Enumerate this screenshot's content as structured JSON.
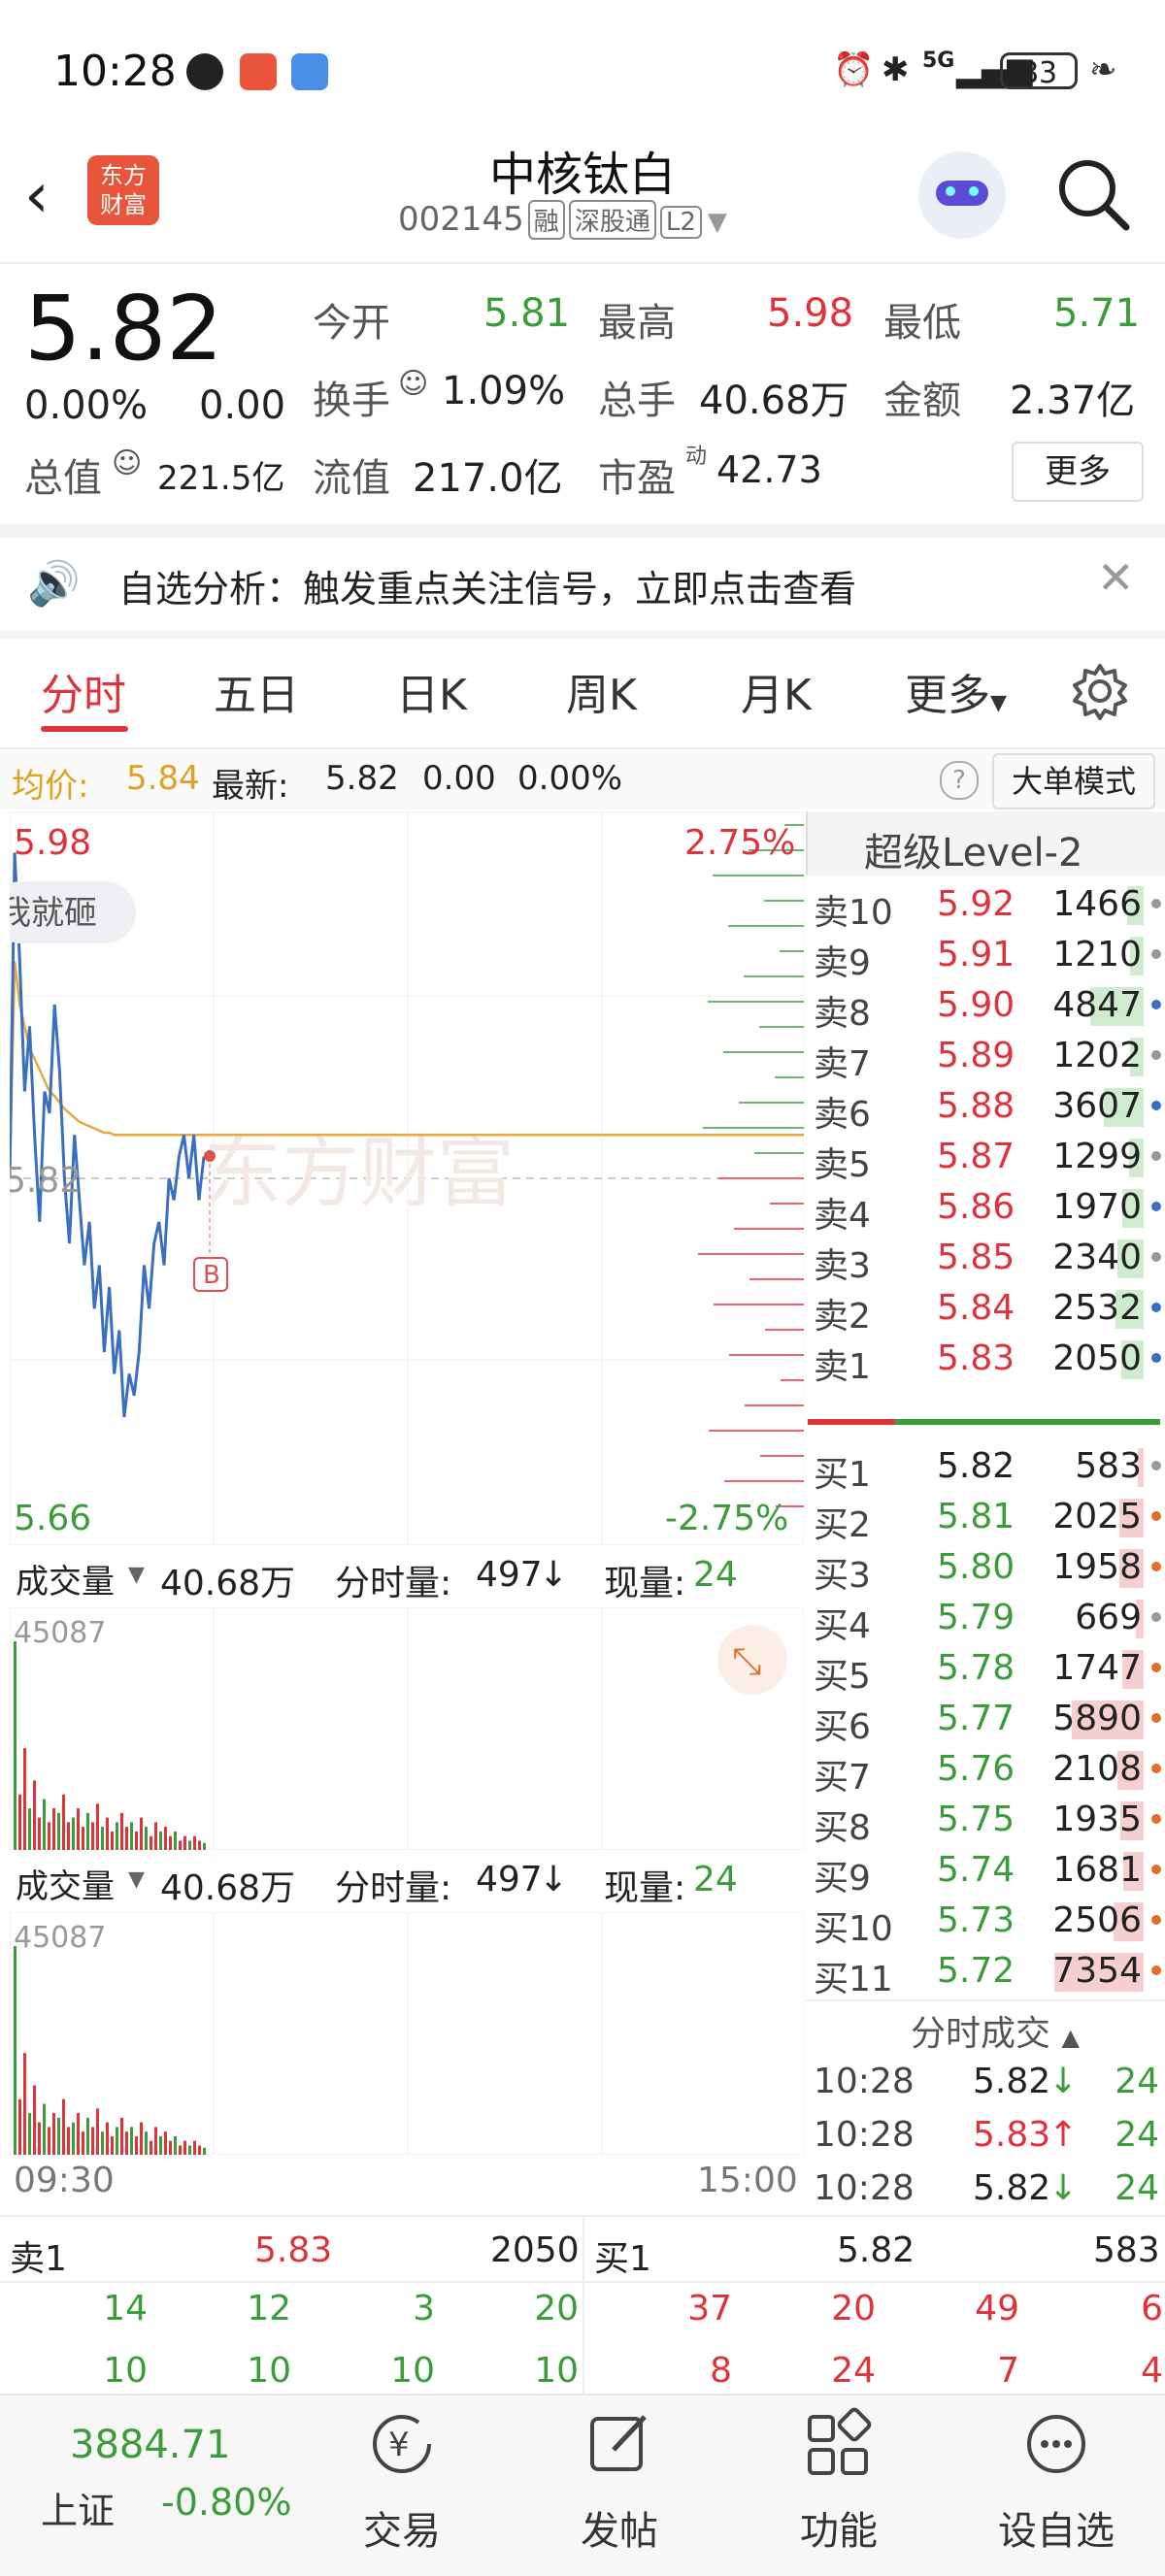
{
  "status_bar": {
    "time": "10:28",
    "network": "5G",
    "battery": "83"
  },
  "header": {
    "logo_text": [
      "东方",
      "财富"
    ],
    "stock_name": "中核钛白",
    "code": "002145",
    "tags": [
      "融",
      "深股通",
      "L2"
    ]
  },
  "quote": {
    "price": "5.82",
    "change_pct": "0.00%",
    "change": "0.00",
    "open_label": "今开",
    "open": "5.81",
    "high_label": "最高",
    "high": "5.98",
    "low_label": "最低",
    "low": "5.71",
    "turnover_label": "换手",
    "turnover": "1.09%",
    "volume_label": "总手",
    "volume": "40.68万",
    "amount_label": "金额",
    "amount": "2.37亿",
    "mktcap_label": "总值",
    "mktcap": "221.5亿",
    "float_label": "流值",
    "float_cap": "217.0亿",
    "pe_label": "市盈",
    "pe_sup": "动",
    "pe": "42.73",
    "more_button": "更多"
  },
  "banner": {
    "text": "自选分析：触发重点关注信号，立即点击查看"
  },
  "tabs": [
    "分时",
    "五日",
    "日K",
    "周K",
    "月K",
    "更多"
  ],
  "chart_info": {
    "avg_label": "均价:",
    "avg": "5.84",
    "latest_label": "最新:",
    "latest": "5.82",
    "chg": "0.00",
    "pct": "0.00%",
    "mode_button": "大单模式"
  },
  "chart_data": {
    "type": "line",
    "title": "",
    "y_top": "5.98",
    "y_bottom": "5.66",
    "pct_top": "2.75%",
    "pct_bottom": "-2.75%",
    "prev_close": "5.82",
    "x_start": "09:30",
    "x_end": "15:00",
    "ylim": [
      5.66,
      5.98
    ],
    "series": [
      {
        "values": [
          5.82,
          5.97,
          5.92,
          5.86,
          5.89,
          5.84,
          5.8,
          5.86,
          5.85,
          5.9,
          5.87,
          5.82,
          5.79,
          5.84,
          5.81,
          5.78,
          5.8,
          5.76,
          5.78,
          5.74,
          5.77,
          5.73,
          5.75,
          5.71,
          5.73,
          5.72,
          5.74,
          5.78,
          5.76,
          5.79,
          5.8,
          5.78,
          5.82,
          5.81,
          5.83,
          5.84,
          5.82,
          5.84,
          5.81,
          5.83
        ]
      },
      {
        "values": [
          5.82,
          5.92,
          5.9,
          5.89,
          5.88,
          5.875,
          5.87,
          5.865,
          5.86,
          5.858,
          5.855,
          5.852,
          5.85,
          5.848,
          5.846,
          5.845,
          5.844,
          5.843,
          5.842,
          5.841,
          5.841,
          5.84,
          5.84,
          5.84,
          5.84,
          5.84,
          5.84,
          5.84,
          5.84,
          5.84,
          5.84,
          5.84,
          5.84,
          5.84,
          5.84,
          5.84,
          5.84,
          5.84,
          5.84,
          5.84
        ]
      }
    ],
    "watermark": "东方财富",
    "comment_bubble": "我就砸",
    "marker": "B"
  },
  "volume_panels": [
    {
      "label": "成交量",
      "total": "40.68万",
      "min_vol_label": "分时量:",
      "min_vol": "497",
      "now_label": "现量:",
      "now": "24",
      "peak": "45087"
    },
    {
      "label": "成交量",
      "total": "40.68万",
      "min_vol_label": "分时量:",
      "min_vol": "497",
      "now_label": "现量:",
      "now": "24",
      "peak": "45087"
    }
  ],
  "volume_bars": [
    45087,
    12000,
    22000,
    9000,
    15000,
    7000,
    11000,
    6000,
    9000,
    8000,
    12000,
    6000,
    7000,
    9000,
    5000,
    8000,
    6000,
    10000,
    5000,
    7000,
    4000,
    6000,
    8000,
    5000,
    6000,
    4000,
    7000,
    5000,
    3000,
    6000,
    4000,
    5000,
    3000,
    4000,
    2000,
    3000,
    2000,
    3000,
    2000,
    1500
  ],
  "level2": {
    "title": "超级Level-2",
    "sells": [
      {
        "label": "卖10",
        "price": "5.92",
        "vol": "1466",
        "dot": "gray",
        "bar": 0.18
      },
      {
        "label": "卖9",
        "price": "5.91",
        "vol": "1210",
        "dot": "gray",
        "bar": 0.15
      },
      {
        "label": "卖8",
        "price": "5.90",
        "vol": "4847",
        "dot": "blue",
        "bar": 0.6
      },
      {
        "label": "卖7",
        "price": "5.89",
        "vol": "1202",
        "dot": "gray",
        "bar": 0.15
      },
      {
        "label": "卖6",
        "price": "5.88",
        "vol": "3607",
        "dot": "blue",
        "bar": 0.45
      },
      {
        "label": "卖5",
        "price": "5.87",
        "vol": "1299",
        "dot": "gray",
        "bar": 0.16
      },
      {
        "label": "卖4",
        "price": "5.86",
        "vol": "1970",
        "dot": "blue",
        "bar": 0.24
      },
      {
        "label": "卖3",
        "price": "5.85",
        "vol": "2340",
        "dot": "gray",
        "bar": 0.29
      },
      {
        "label": "卖2",
        "price": "5.84",
        "vol": "2532",
        "dot": "blue",
        "bar": 0.31
      },
      {
        "label": "卖1",
        "price": "5.83",
        "vol": "2050",
        "dot": "blue",
        "bar": 0.25
      }
    ],
    "buys": [
      {
        "label": "买1",
        "price": "5.82",
        "vol": "583",
        "dot": "gray",
        "bar": 0.07
      },
      {
        "label": "买2",
        "price": "5.81",
        "vol": "2025",
        "dot": "orange",
        "bar": 0.27
      },
      {
        "label": "买3",
        "price": "5.80",
        "vol": "1958",
        "dot": "orange",
        "bar": 0.27
      },
      {
        "label": "买4",
        "price": "5.79",
        "vol": "669",
        "dot": "gray",
        "bar": 0.09
      },
      {
        "label": "买5",
        "price": "5.78",
        "vol": "1747",
        "dot": "orange",
        "bar": 0.24
      },
      {
        "label": "买6",
        "price": "5.77",
        "vol": "5890",
        "dot": "orange",
        "bar": 0.8
      },
      {
        "label": "买7",
        "price": "5.76",
        "vol": "2108",
        "dot": "orange",
        "bar": 0.29
      },
      {
        "label": "买8",
        "price": "5.75",
        "vol": "1935",
        "dot": "orange",
        "bar": 0.26
      },
      {
        "label": "买9",
        "price": "5.74",
        "vol": "1681",
        "dot": "orange",
        "bar": 0.23
      },
      {
        "label": "买10",
        "price": "5.73",
        "vol": "2506",
        "dot": "orange",
        "bar": 0.34
      },
      {
        "label": "买11",
        "price": "5.72",
        "vol": "7354",
        "dot": "orange",
        "bar": 1.0
      }
    ],
    "trades_title": "分时成交",
    "trades": [
      {
        "time": "10:28",
        "price": "5.82",
        "dir": "↓",
        "vol": "24",
        "color": "green"
      },
      {
        "time": "10:28",
        "price": "5.83",
        "dir": "↑",
        "vol": "24",
        "color": "red"
      },
      {
        "time": "10:28",
        "price": "5.82",
        "dir": "↓",
        "vol": "24",
        "color": "green"
      }
    ]
  },
  "bottom_quotes": {
    "sell1_label": "卖1",
    "sell1_price": "5.83",
    "sell1_vol": "2050",
    "buy1_label": "买1",
    "buy1_price": "5.82",
    "buy1_vol": "583",
    "left_row1": [
      "14",
      "12",
      "3",
      "20"
    ],
    "left_row2": [
      "10",
      "10",
      "10",
      "10"
    ],
    "right_row1": [
      "37",
      "20",
      "49",
      "6"
    ],
    "right_row2": [
      "8",
      "24",
      "7",
      "4"
    ]
  },
  "bottom_nav": {
    "index_value": "3884.71",
    "index_name": "上证",
    "index_change": "-0.80%",
    "items": [
      "交易",
      "发帖",
      "功能",
      "设自选"
    ]
  }
}
